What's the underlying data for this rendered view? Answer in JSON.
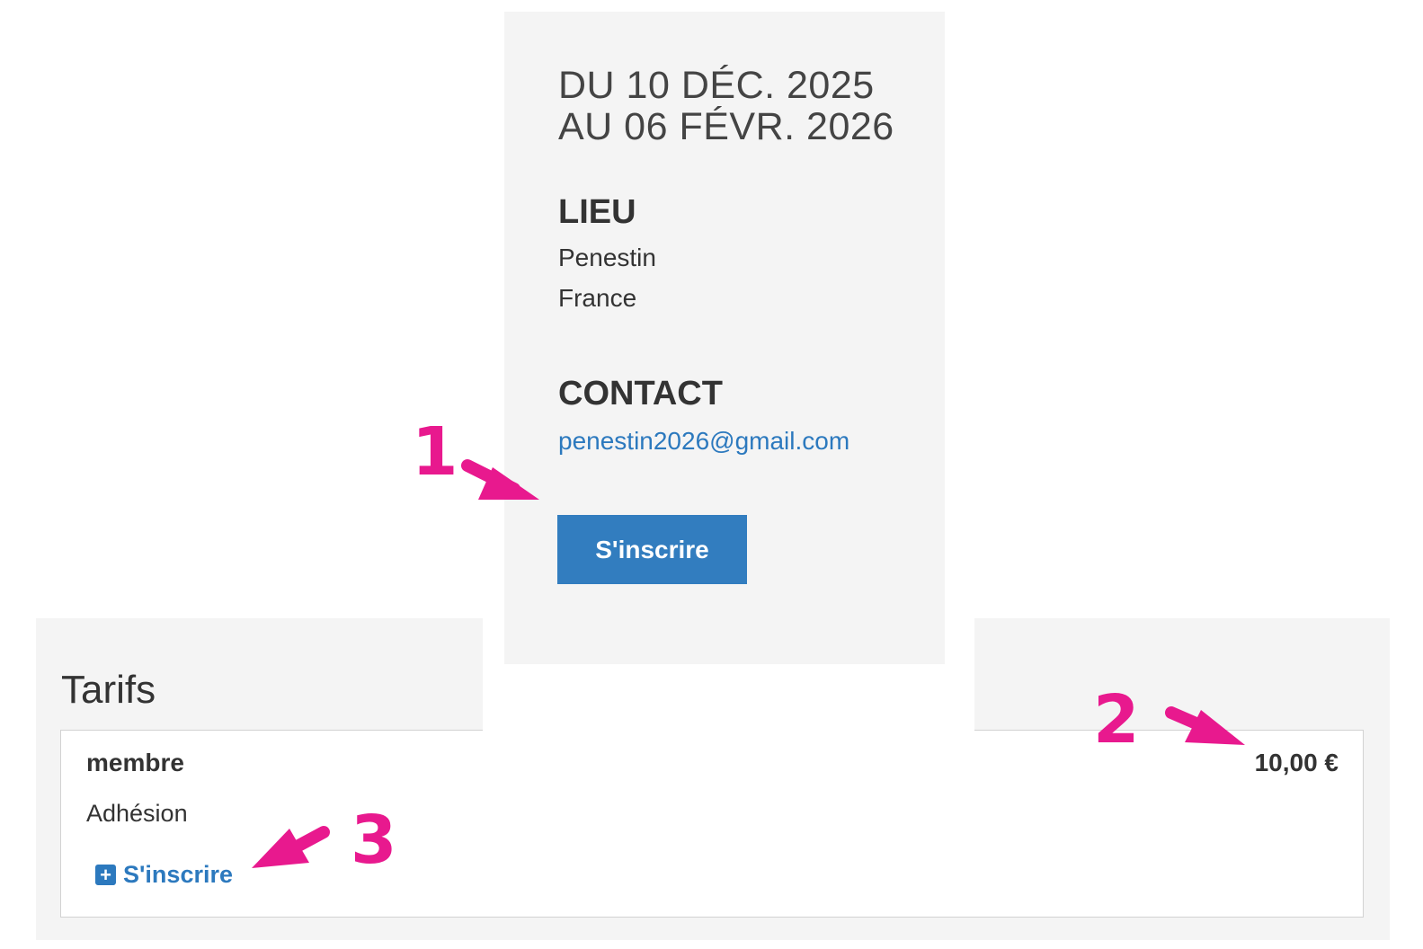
{
  "event": {
    "date_line1": "DU 10 DÉC. 2025",
    "date_line2": "AU 06 FÉVR. 2026",
    "location_heading": "LIEU",
    "location_city": "Penestin",
    "location_country": "France",
    "contact_heading": "CONTACT",
    "contact_email": "penestin2026@gmail.com",
    "subscribe_button": "S'inscrire"
  },
  "tarifs": {
    "title": "Tarifs",
    "items": [
      {
        "name": "membre",
        "price": "10,00 €",
        "description": "Adhésion",
        "subscribe_link": "S'inscrire"
      }
    ]
  },
  "annotations": {
    "markers": [
      "1",
      "2",
      "3"
    ],
    "color": "#e8198e"
  },
  "colors": {
    "accent": "#327dbf",
    "link": "#2c79be",
    "panel_bg": "#f4f4f4"
  },
  "icons": {
    "plus": "plus-square-icon"
  }
}
